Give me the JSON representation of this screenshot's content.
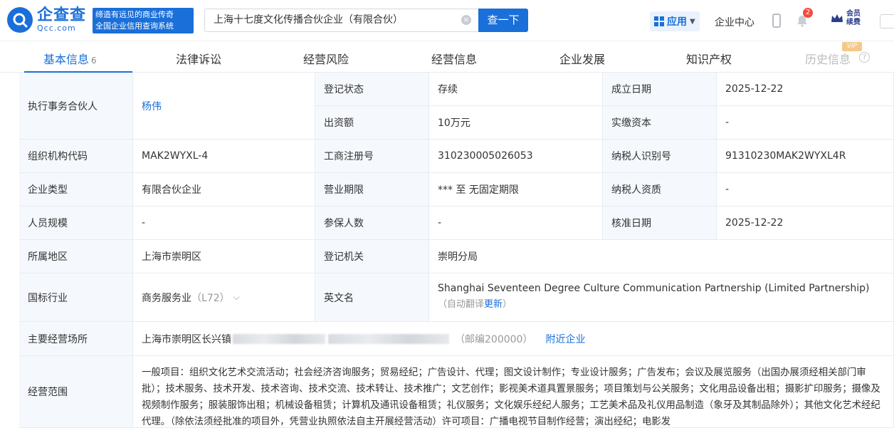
{
  "brand": {
    "name_cn": "企查查",
    "name_en": "Qcc.com",
    "slogan_line1": "缔造有远见的商业传奇",
    "slogan_line2": "全国企业信用查询系统"
  },
  "search": {
    "value": "上海十七度文化传播合伙企业（有限合伙）",
    "button_label": "查一下"
  },
  "header": {
    "apps_label": "应用",
    "center_label": "企业中心",
    "notification_count": "2",
    "vip_line1": "会员",
    "vip_line2": "续费"
  },
  "tabs": [
    {
      "label": "基本信息",
      "count": "6"
    },
    {
      "label": "法律诉讼"
    },
    {
      "label": "经营风险"
    },
    {
      "label": "经营信息"
    },
    {
      "label": "企业发展"
    },
    {
      "label": "知识产权"
    },
    {
      "label": "历史信息",
      "tag": "VIP"
    }
  ],
  "info": {
    "partner_label": "执行事务合伙人",
    "partner_value": "杨伟",
    "reg_status_label": "登记状态",
    "reg_status_value": "存续",
    "found_date_label": "成立日期",
    "found_date_value": "2025-12-22",
    "capital_label": "出资额",
    "capital_value": "10万元",
    "paid_capital_label": "实缴资本",
    "paid_capital_value": "-",
    "org_code_label": "组织机构代码",
    "org_code_value": "MAK2WYXL-4",
    "biz_reg_label": "工商注册号",
    "biz_reg_value": "310230005026053",
    "taxpayer_id_label": "纳税人识别号",
    "taxpayer_id_value": "91310230MAK2WYXL4R",
    "type_label": "企业类型",
    "type_value": "有限合伙企业",
    "term_label": "营业期限",
    "term_value": "*** 至 无固定期限",
    "taxpayer_qual_label": "纳税人资质",
    "taxpayer_qual_value": "-",
    "staff_label": "人员规模",
    "staff_value": "-",
    "insured_label": "参保人数",
    "insured_value": "-",
    "approve_date_label": "核准日期",
    "approve_date_value": "2025-12-22",
    "region_label": "所属地区",
    "region_value": "上海市崇明区",
    "authority_label": "登记机关",
    "authority_value": "崇明分局",
    "industry_label": "国标行业",
    "industry_value": "商务服务业",
    "industry_code": "（L72）",
    "en_name_label": "英文名",
    "en_name_value": "Shanghai Seventeen Degree Culture Communication Partnership (Limited Partnership)",
    "en_name_note": "（自动翻译",
    "en_name_update": "更新",
    "en_name_note_end": "）",
    "address_label": "主要经营场所",
    "address_value": "上海市崇明区长兴镇",
    "postcode": "（邮编200000）",
    "nearby_link": "附近企业",
    "scope_label": "经营范围",
    "scope_value": "一般项目：组织文化艺术交流活动；社会经济咨询服务；贸易经纪；广告设计、代理；图文设计制作；专业设计服务；广告发布；会议及展览服务（出国办展须经相关部门审批）；技术服务、技术开发、技术咨询、技术交流、技术转让、技术推广；文艺创作；影视美术道具置景服务；项目策划与公关服务；文化用品设备出租；摄影扩印服务；摄像及视频制作服务；服装服饰出租；机械设备租赁；计算机及通讯设备租赁；礼仪服务；文化娱乐经纪人服务；工艺美术品及礼仪用品制造（象牙及其制品除外）；其他文化艺术经纪代理。（除依法须经批准的项目外，凭营业执照依法自主开展经营活动）许可项目：广播电视节目制作经营；演出经纪；电影发"
  }
}
